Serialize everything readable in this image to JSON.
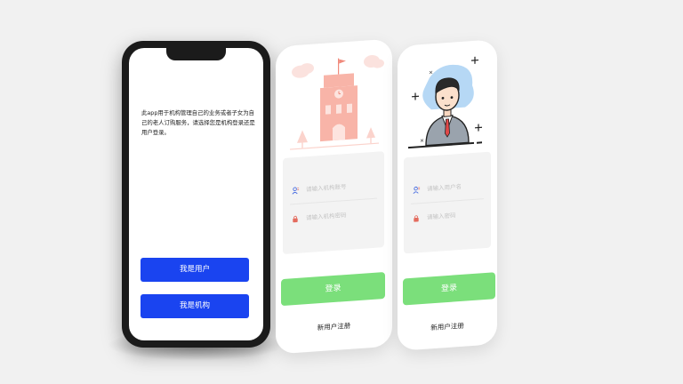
{
  "screen1": {
    "intro_text": "此app用于机构管理自己的业务或者子女为自己的老人订购服务，请选择您是机构登录还是用户登录。",
    "user_button": "我是用户",
    "org_button": "我是机构"
  },
  "screen2": {
    "account_placeholder": "请输入机构账号",
    "password_placeholder": "请输入机构密码",
    "login_button": "登录",
    "register_link": "新用户注册"
  },
  "screen3": {
    "username_placeholder": "请输入用户名",
    "password_placeholder": "请输入密码",
    "login_button": "登录",
    "register_link": "新用户注册"
  },
  "colors": {
    "primary_blue": "#1a44f0",
    "login_green": "#7bdf7b",
    "illustration_pink": "#f8b4a8",
    "field_background": "#f3f3f3"
  },
  "icons": [
    "user-icon",
    "lock-icon",
    "school-building-illustration",
    "businessman-illustration",
    "sparkle-icon"
  ]
}
